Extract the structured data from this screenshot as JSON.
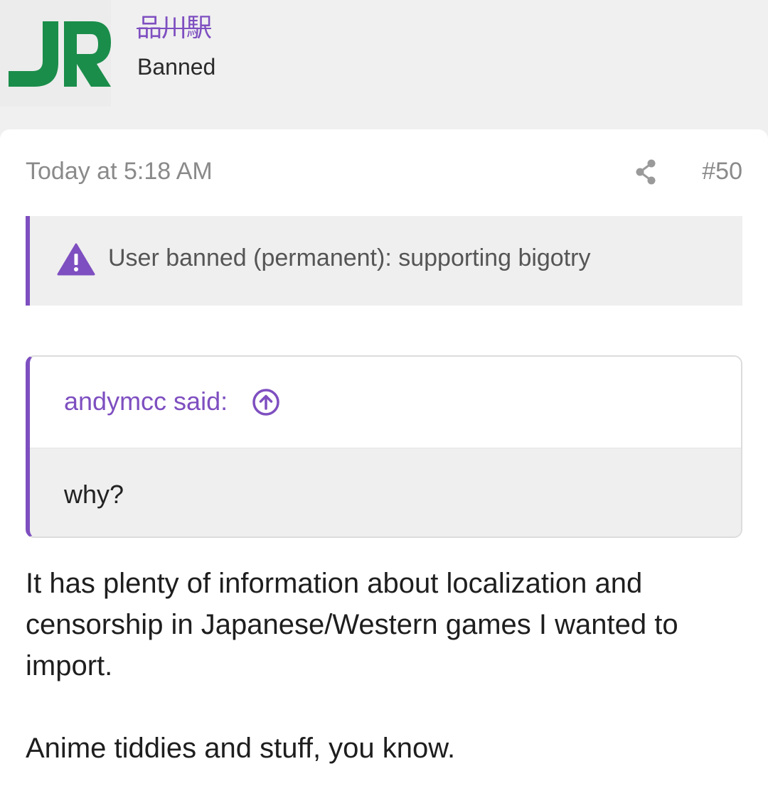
{
  "user": {
    "name": "品川駅",
    "title": "Banned",
    "avatar_icon": "jr-logo-avatar",
    "avatar_color": "#1a8d4a",
    "name_color": "#7e4fc0"
  },
  "post": {
    "timestamp": "Today at 5:18 AM",
    "number": "#50",
    "share_icon": "share-icon",
    "ban_notice": {
      "icon": "warning-icon",
      "text": "User banned (permanent): supporting bigotry"
    },
    "quote": {
      "author": "andymcc said:",
      "jump_icon": "arrow-up-circle-icon",
      "text": "why?"
    },
    "body": [
      "It has plenty of information about localization and censorship in Japanese/Western games I wanted to import.",
      "Anime tiddies and stuff, you know."
    ]
  },
  "colors": {
    "accent": "#7e4fc0",
    "background": "#f0f0f0",
    "card": "#ffffff"
  }
}
